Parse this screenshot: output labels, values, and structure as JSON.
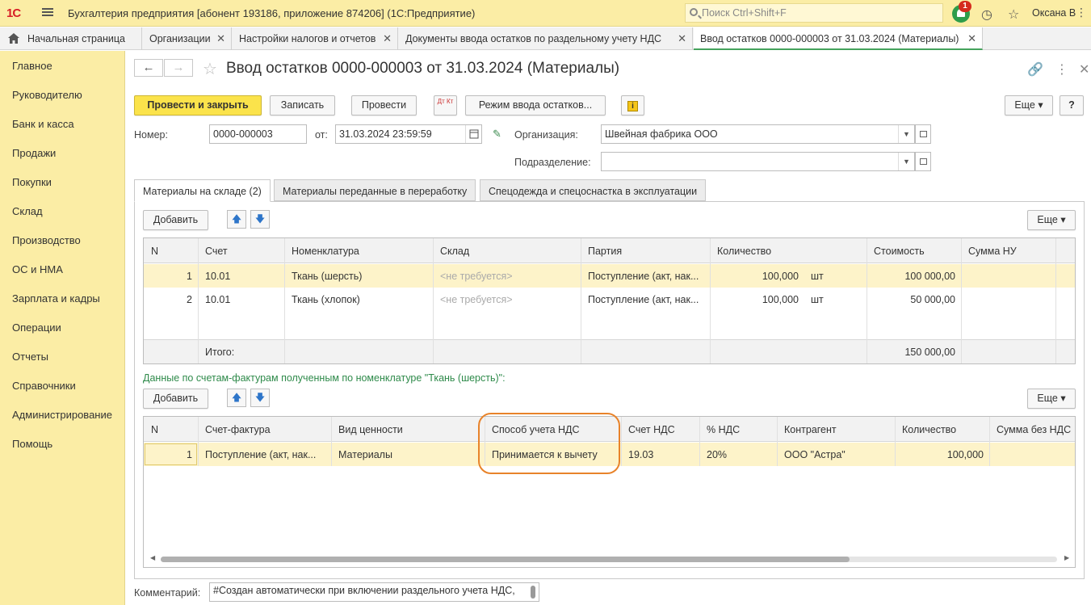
{
  "app": {
    "logo": "1С",
    "title": "Бухгалтерия предприятия [абонент 193186, приложение 874206]  (1С:Предприятие)",
    "search_placeholder": "Поиск Ctrl+Shift+F",
    "notif_count": "1",
    "user": "Оксана В"
  },
  "tabs": [
    {
      "label": "Начальная страница"
    },
    {
      "label": "Организации"
    },
    {
      "label": "Настройки налогов и отчетов"
    },
    {
      "label": "Документы ввода остатков по раздельному учету НДС"
    },
    {
      "label": "Ввод остатков 0000-000003 от 31.03.2024 (Материалы)"
    }
  ],
  "sidebar": [
    "Главное",
    "Руководителю",
    "Банк и касса",
    "Продажи",
    "Покупки",
    "Склад",
    "Производство",
    "ОС и НМА",
    "Зарплата и кадры",
    "Операции",
    "Отчеты",
    "Справочники",
    "Администрирование",
    "Помощь"
  ],
  "doc": {
    "title": "Ввод остатков 0000-000003 от 31.03.2024 (Материалы)",
    "btn_post_close": "Провести и закрыть",
    "btn_save": "Записать",
    "btn_post": "Провести",
    "btn_dtkt": "Дт Кт",
    "btn_mode": "Режим ввода остатков...",
    "btn_more": "Еще",
    "btn_help": "?",
    "number_label": "Номер:",
    "number": "0000-000003",
    "date_label": "от:",
    "date": "31.03.2024 23:59:59",
    "org_label": "Организация:",
    "org": "Швейная фабрика ООО",
    "dept_label": "Подразделение:",
    "dept": ""
  },
  "ptabs": [
    "Материалы на складе (2)",
    "Материалы переданные в переработку",
    "Спецодежда и спецоснастка в эксплуатации"
  ],
  "grid1": {
    "add": "Добавить",
    "more": "Еще",
    "headers": [
      "N",
      "Счет",
      "Номенклатура",
      "Склад",
      "Партия",
      "Количество",
      "Стоимость",
      "Сумма НУ"
    ],
    "rows": [
      {
        "n": "1",
        "acc": "10.01",
        "item": "Ткань (шерсть)",
        "wh": "<не требуется>",
        "batch": "Поступление (акт, нак...",
        "qty": "100,000",
        "unit": "шт",
        "cost": "100 000,00"
      },
      {
        "n": "2",
        "acc": "10.01",
        "item": "Ткань (хлопок)",
        "wh": "<не требуется>",
        "batch": "Поступление (акт, нак...",
        "qty": "100,000",
        "unit": "шт",
        "cost": "50 000,00"
      }
    ],
    "total_label": "Итого:",
    "total": "150 000,00"
  },
  "invoice_caption": "Данные по счетам-фактурам полученным по номенклатуре \"Ткань (шерсть)\":",
  "grid2": {
    "add": "Добавить",
    "more": "Еще",
    "headers": [
      "N",
      "Счет-фактура",
      "Вид ценности",
      "Способ учета НДС",
      "Счет НДС",
      "% НДС",
      "Контрагент",
      "Количество",
      "Сумма без НДС"
    ],
    "rows": [
      {
        "n": "1",
        "inv": "Поступление (акт, нак...",
        "kind": "Материалы",
        "method": "Принимается к вычету",
        "vat_acc": "19.03",
        "rate": "20%",
        "partner": "ООО \"Астра\"",
        "qty": "100,000",
        "sum": ""
      }
    ]
  },
  "comment_label": "Комментарий:",
  "comment": "#Создан автоматически при включении раздельного учета НДС,",
  "colors": {
    "accent": "#fbeda5",
    "primary_btn": "#fbe34b",
    "highlight": "#e8832a",
    "caption": "#2e8a4a"
  }
}
